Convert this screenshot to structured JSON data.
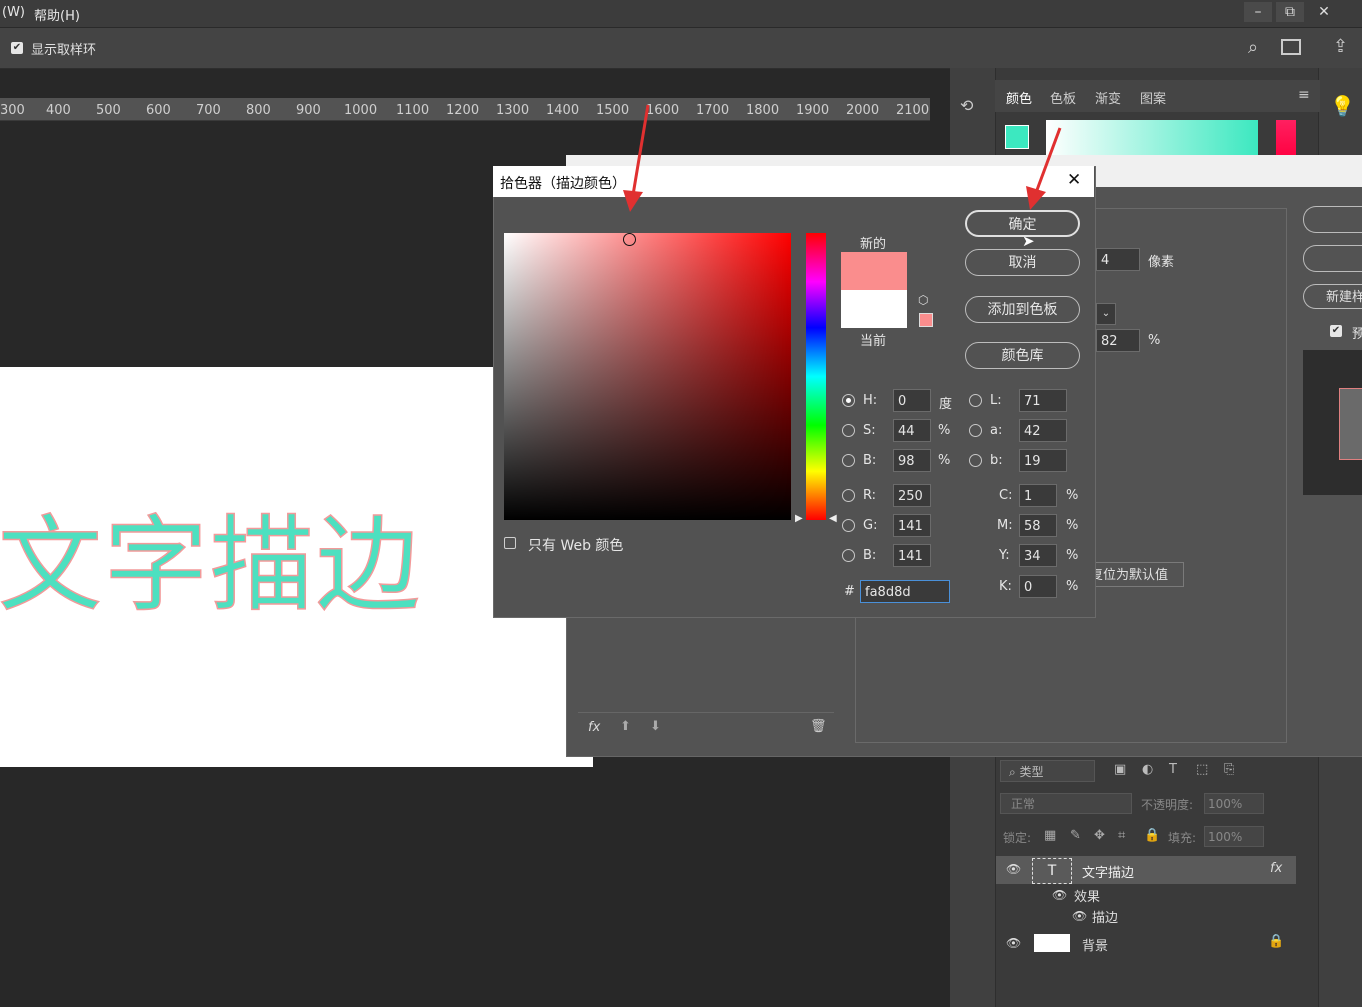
{
  "menubar": {
    "items": [
      "(W)",
      "帮助(H)"
    ],
    "minimize": "–",
    "restore": "⧉",
    "close": "✕"
  },
  "options": {
    "show_sampling_ring": "显示取样环"
  },
  "ruler": {
    "ticks": [
      "300",
      "400",
      "500",
      "600",
      "700",
      "800",
      "900",
      "1000",
      "1100",
      "1200",
      "1300",
      "1400",
      "1500",
      "1600",
      "1700",
      "1800",
      "1900",
      "2000",
      "2100"
    ]
  },
  "canvas": {
    "text": "文字描边",
    "fill_color": "#4de0c0",
    "stroke_color": "#f29a9a"
  },
  "color_panel": {
    "tabs": [
      "颜色",
      "色板",
      "渐变",
      "图案"
    ],
    "foreground": "#3ce8c0"
  },
  "layer_style": {
    "size_value": "4",
    "size_unit": "像素",
    "opacity_value": "82",
    "opacity_unit": "%",
    "reset_default": "复位为默认值",
    "new_style": "新建样",
    "preview": "预"
  },
  "picker": {
    "title": "拾色器（描边颜色）",
    "new_label": "新的",
    "current_label": "当前",
    "new_color": "#fa8d8d",
    "current_color": "#ffffff",
    "ok": "确定",
    "cancel": "取消",
    "add_to_swatches": "添加到色板",
    "color_libraries": "颜色库",
    "web_only": "只有 Web 颜色",
    "H": "0",
    "S": "44",
    "B": "98",
    "R": "250",
    "G": "141",
    "B2": "141",
    "L": "71",
    "a": "42",
    "b": "19",
    "C": "1",
    "M": "58",
    "Y": "34",
    "K": "0",
    "deg": "度",
    "pct": "%",
    "hex": "fa8d8d",
    "labels": {
      "H": "H:",
      "S": "S:",
      "B": "B:",
      "R": "R:",
      "G": "G:",
      "B2": "B:",
      "L": "L:",
      "a": "a:",
      "b": "b:",
      "C": "C:",
      "M": "M:",
      "Y": "Y:",
      "K": "K:",
      "hash": "#"
    }
  },
  "layers": {
    "filter": "类型",
    "blend": "正常",
    "opacity_label": "不透明度:",
    "opacity": "100%",
    "lock_label": "锁定:",
    "fill_label": "填充:",
    "fill": "100%",
    "items": [
      {
        "name": "文字描边",
        "fx": "fx"
      },
      {
        "name": "效果"
      },
      {
        "name": "描边"
      },
      {
        "name": "背景"
      }
    ]
  }
}
